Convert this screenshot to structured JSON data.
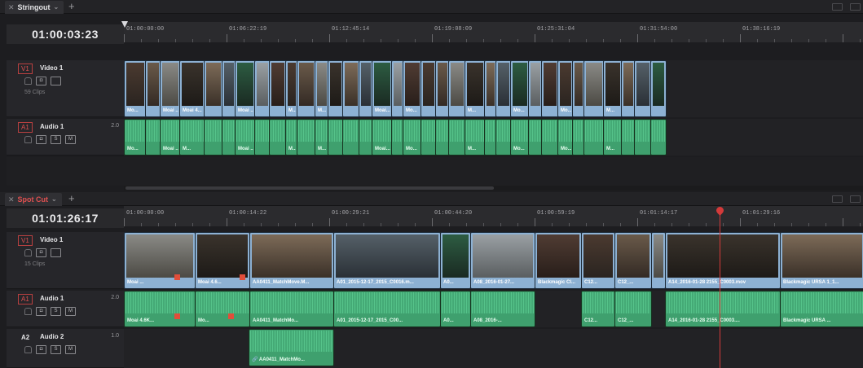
{
  "top": {
    "tab_label": "Stringout",
    "timecode": "01:00:03:23",
    "ruler": [
      "01:00:00:00",
      "01:06:22:19",
      "01:12:45:14",
      "01:19:08:09",
      "01:25:31:04",
      "01:31:54:00",
      "01:38:16:19"
    ],
    "video_track": {
      "badge": "V1",
      "name": "Video 1",
      "count": "59 Clips"
    },
    "audio_track": {
      "badge": "A1",
      "name": "Audio 1",
      "channels": "2.0"
    },
    "video_labels": [
      "Mo...",
      "Moai ...",
      "Moai 4...",
      "Moai ...",
      "M...",
      "M...",
      "Moai...",
      "Mo...",
      "M...",
      "Mo...",
      "Mo...",
      "M..."
    ],
    "audio_labels": [
      "Mo...",
      "Moai ...",
      "M...",
      "Moai ...",
      "M...",
      "M...",
      "Moai...",
      "Mo...",
      "M...",
      "Mo...",
      "Mo...",
      "M..."
    ]
  },
  "bottom": {
    "tab_label": "Spot Cut",
    "timecode": "01:01:26:17",
    "ruler": [
      "01:00:00:00",
      "01:00:14:22",
      "01:00:29:21",
      "01:00:44:20",
      "01:00:59:19",
      "01:01:14:17",
      "01:01:29:16"
    ],
    "v1": {
      "badge": "V1",
      "name": "Video 1",
      "count": "15 Clips"
    },
    "a1": {
      "badge": "A1",
      "name": "Audio 1",
      "channels": "2.0"
    },
    "a2": {
      "badge": "A2",
      "name": "Audio 2",
      "channels": "1.0"
    },
    "video_labels": [
      "Moai ...",
      "Moai 4.6...",
      "AA0411_MatchMove.M...",
      "A01_2015-12-17_2015_C0016.m...",
      "A0...",
      "A08_2016-01-27...",
      "Blackmagic Cl...",
      "C12...",
      "C12_...",
      "A14_2016-01-28 2155_C0003.mov",
      "Blackmagic URSA 1_1..."
    ],
    "audio_labels": [
      "Moai 4.6K...",
      "Mo...",
      "AA0411_MatchMo...",
      "A01_2015-12-17_2015_C00...",
      "A0...",
      "A08_2016-...",
      "C12...",
      "C12_...",
      "A14_2016-01-28 2155_C0003....",
      "Blackmagic URSA ..."
    ],
    "a2_label": "AA0411_MatchMo..."
  },
  "colors": {
    "video_clip": "#8db1d3",
    "audio_clip": "#3fa06e",
    "playhead": "#d43a3a",
    "track_badge": "#e05050"
  },
  "icons": [
    "close-icon",
    "chevron-down-icon",
    "plus-icon",
    "lock-icon",
    "monitor-icon",
    "solo-icon",
    "mute-icon",
    "link-icon",
    "playhead-icon"
  ]
}
